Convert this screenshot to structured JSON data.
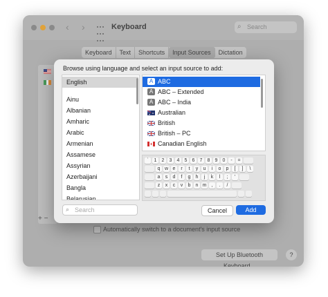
{
  "window": {
    "title": "Keyboard",
    "search_placeholder": "Search",
    "tabs": [
      {
        "label": "Keyboard"
      },
      {
        "label": "Text"
      },
      {
        "label": "Shortcuts"
      },
      {
        "label": "Input Sources",
        "selected": true
      },
      {
        "label": "Dictation"
      }
    ],
    "auto_switch_label": "Automatically switch to a document's input source",
    "bluetooth_button": "Set Up Bluetooth Keyboard...",
    "help_button": "?",
    "add_remove": "+ −"
  },
  "sheet": {
    "heading": "Browse using language and select an input source to add:",
    "languages": [
      "English",
      "Ainu",
      "Albanian",
      "Amharic",
      "Arabic",
      "Armenian",
      "Assamese",
      "Assyrian",
      "Azerbaijani",
      "Bangla",
      "Belarusian"
    ],
    "selected_language": "English",
    "sources": [
      {
        "label": "ABC",
        "icon": "abc-icon",
        "selected": true
      },
      {
        "label": "ABC – Extended",
        "icon": "abc-icon"
      },
      {
        "label": "ABC – India",
        "icon": "abc-icon"
      },
      {
        "label": "Australian",
        "icon": "australia-flag-icon"
      },
      {
        "label": "British",
        "icon": "uk-flag-icon"
      },
      {
        "label": "British – PC",
        "icon": "uk-flag-icon"
      },
      {
        "label": "Canadian English",
        "icon": "canada-flag-icon"
      }
    ],
    "keyboard_rows": [
      [
        "`",
        "1",
        "2",
        "3",
        "4",
        "5",
        "6",
        "7",
        "8",
        "9",
        "0",
        "-",
        "=",
        ""
      ],
      [
        "",
        "q",
        "w",
        "e",
        "r",
        "t",
        "y",
        "u",
        "i",
        "o",
        "p",
        "[",
        "]",
        "\\"
      ],
      [
        "",
        "a",
        "s",
        "d",
        "f",
        "g",
        "h",
        "j",
        "k",
        "l",
        ";",
        "'",
        ""
      ],
      [
        "",
        "z",
        "x",
        "c",
        "v",
        "b",
        "n",
        "m",
        ",",
        ".",
        "/",
        ""
      ],
      [
        " "
      ]
    ],
    "search_placeholder": "Search",
    "cancel_label": "Cancel",
    "add_label": "Add"
  },
  "colors": {
    "accent": "#1e6be1",
    "window_dim": "#aeaeae",
    "sheet_bg": "#ececec"
  }
}
